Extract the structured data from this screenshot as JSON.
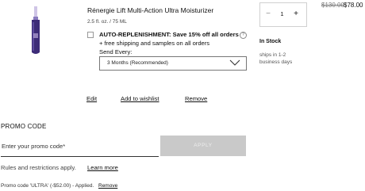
{
  "product": {
    "title": "Rénergie Lift Multi-Action Ultra Moisturizer",
    "size": "2.5 fl. oz. / 75 ML"
  },
  "auto_replenishment": {
    "label_bold": "AUTO-REPLENISHMENT: Save 15% off all orders",
    "info_icon_glyph": "?",
    "benefit": "+ free shipping and samples on all orders",
    "send_every_label": "Send Every:",
    "frequency_selected": "3 Months (Recommended)"
  },
  "quantity": {
    "minus": "−",
    "value": "1",
    "plus": "+"
  },
  "price": {
    "original": "$130.00",
    "current": "$78.00"
  },
  "availability": {
    "status": "In Stock",
    "ships_line1": "ships in 1-2",
    "ships_line2": "business days"
  },
  "actions": {
    "edit": "Edit",
    "add_to_wishlist": "Add to wishlist",
    "remove": "Remove"
  },
  "promo": {
    "heading": "PROMO CODE",
    "placeholder": "Enter your promo code*",
    "apply_label": "APPLY",
    "rules_text": "Rules and restrictions apply.",
    "learn_more": "Learn more",
    "applied_text": "Promo code 'ULTRA' (-$52.00) - Applied.",
    "applied_remove": "Remove"
  },
  "colors": {
    "bottle": "#3d2c78",
    "cap": "#c9b9e6",
    "apply_button": "#c9c9c9"
  },
  "icons": {
    "product_image": "serum-bottle-image",
    "select_arrow": "chevron-down-icon",
    "info": "info-icon"
  }
}
